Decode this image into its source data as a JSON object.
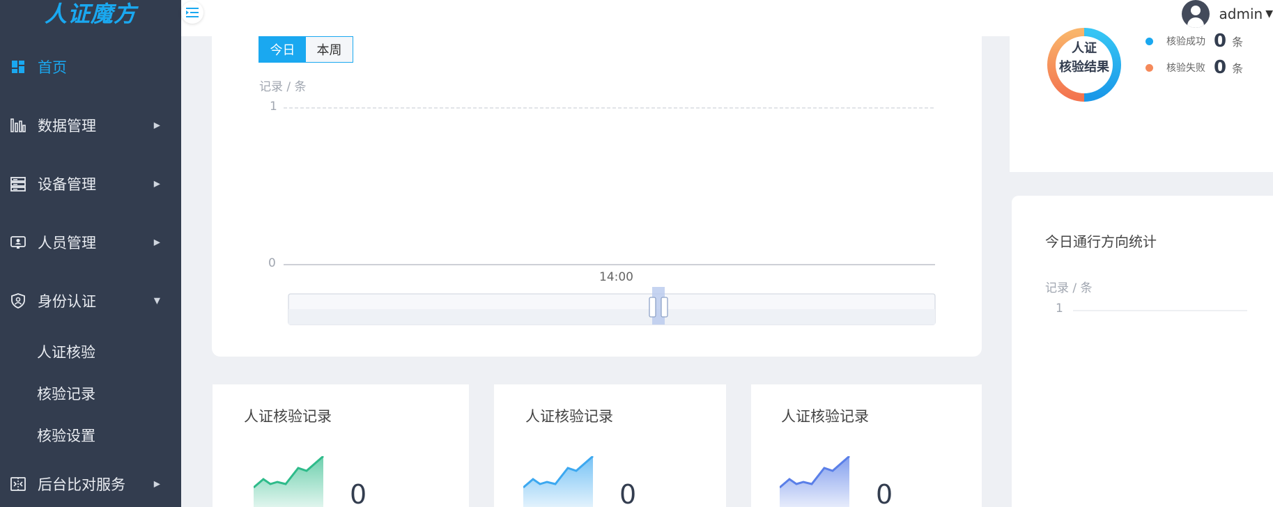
{
  "app": {
    "logo_text": "人证魔方"
  },
  "header": {
    "user_name": "admin"
  },
  "sidebar": {
    "items": [
      {
        "label": "首页",
        "icon": "dashboard-icon",
        "active": true
      },
      {
        "label": "数据管理",
        "icon": "bar-chart-icon"
      },
      {
        "label": "设备管理",
        "icon": "server-icon"
      },
      {
        "label": "人员管理",
        "icon": "monitor-person-icon"
      },
      {
        "label": "身份认证",
        "icon": "shield-user-icon",
        "expanded": true
      },
      {
        "label": "后台比对服务",
        "icon": "compare-icon"
      }
    ],
    "sub_items": [
      "人证核验",
      "核验记录",
      "核验设置"
    ]
  },
  "main_chart": {
    "tabs": [
      "今日",
      "本周"
    ],
    "active_tab": "今日",
    "unit_label": "记录 / 条",
    "y_ticks": [
      "1",
      "0"
    ],
    "x_label": "14:00"
  },
  "verification_result": {
    "ring_line1": "人证",
    "ring_line2": "核验结果",
    "legend": [
      {
        "label": "核验成功",
        "value": "0",
        "unit": "条",
        "color": "#1aa8f0"
      },
      {
        "label": "核验失败",
        "value": "0",
        "unit": "条",
        "color": "#f5895a"
      }
    ]
  },
  "direction_stats": {
    "title": "今日通行方向统计",
    "unit_label": "记录 / 条",
    "y_tick": "1"
  },
  "cards": [
    {
      "title": "人证核验记录",
      "value": "0",
      "color": "#2ebb8a"
    },
    {
      "title": "人证核验记录",
      "value": "0",
      "color": "#3ca8f0"
    },
    {
      "title": "人证核验记录",
      "value": "0",
      "color": "#5a7fe8"
    }
  ],
  "chart_data": {
    "type": "line",
    "ylabel": "记录 / 条",
    "ylim": [
      0,
      1
    ],
    "y_ticks": [
      0,
      1
    ],
    "x_ticks": [
      "14:00"
    ],
    "series": [],
    "grid": true
  }
}
